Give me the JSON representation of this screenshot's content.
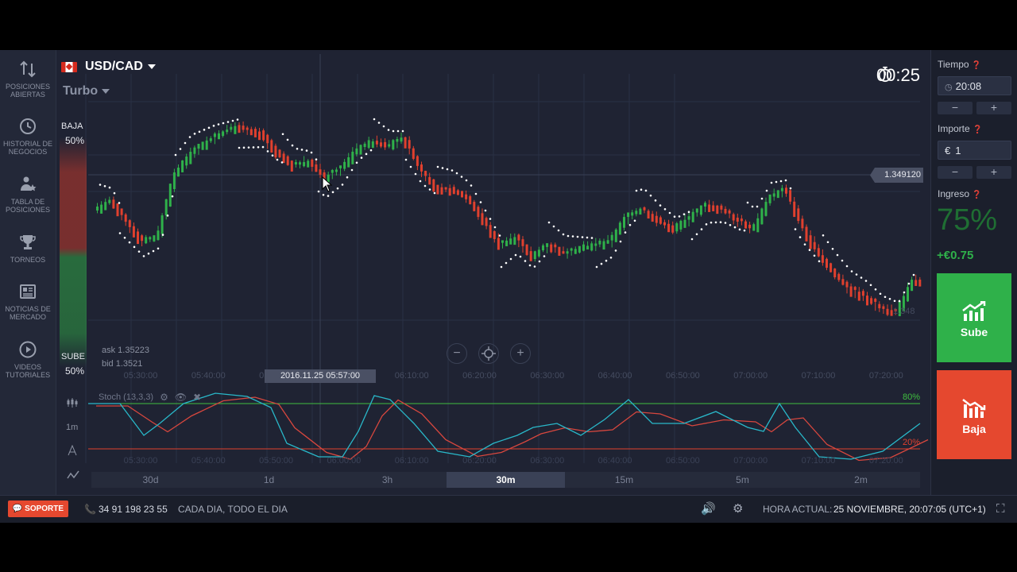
{
  "sidebar": {
    "items": [
      {
        "label1": "POSICIONES",
        "label2": "ABIERTAS",
        "icon": "up-down-arrows-icon"
      },
      {
        "label1": "HISTORIAL DE",
        "label2": "NEGOCIOS",
        "icon": "history-clock-icon"
      },
      {
        "label1": "TABLA DE",
        "label2": "POSICIONES",
        "icon": "leaderboard-icon"
      },
      {
        "label1": "TORNEOS",
        "label2": "",
        "icon": "trophy-icon"
      },
      {
        "label1": "NOTICIAS DE",
        "label2": "MERCADO",
        "icon": "newspaper-icon"
      },
      {
        "label1": "VIDEOS",
        "label2": "TUTORIALES",
        "icon": "play-circle-icon"
      }
    ]
  },
  "header": {
    "pair": "USD/CAD",
    "mode": "Turbo",
    "timer": "00:25"
  },
  "sentiment": {
    "baja_label": "BAJA",
    "baja_pct": "50%",
    "sube_label": "SUBE",
    "sube_pct": "50%"
  },
  "quotes": {
    "ask": "ask 1.35223",
    "bid": "bid 1.3521",
    "current_price": "1.349120",
    "faint_price": "1.348",
    "cursor_time": "2016.11.25 05:57:00"
  },
  "time_axis": [
    "05:30:00",
    "05:40:00",
    "05:50:00",
    "06:00:00",
    "06:10:00",
    "06:20:00",
    "06:30:00",
    "06:40:00",
    "06:50:00",
    "07:00:00",
    "07:10:00",
    "07:20:00"
  ],
  "indicator": {
    "name": "Stoch (13,3,3)",
    "level_high": "80%",
    "level_low": "20%",
    "tools": [
      "1m"
    ]
  },
  "timeframes": [
    {
      "label": "30d",
      "active": false
    },
    {
      "label": "1d",
      "active": false
    },
    {
      "label": "3h",
      "active": false
    },
    {
      "label": "30m",
      "active": true
    },
    {
      "label": "15m",
      "active": false
    },
    {
      "label": "5m",
      "active": false
    },
    {
      "label": "2m",
      "active": false
    }
  ],
  "right_panel": {
    "tiempo_label": "Tiempo",
    "tiempo_value": "20:08",
    "importe_label": "Importe",
    "importe_currency": "€",
    "importe_value": "1",
    "ingreso_label": "Ingreso",
    "ingreso_pct": "75%",
    "ingreso_amount": "+€0.75",
    "sube_label": "Sube",
    "baja_label": "Baja",
    "minus": "−",
    "plus": "+"
  },
  "footer": {
    "support": "SOPORTE",
    "phone": "34 91 198 23 55",
    "schedule": "CADA DIA, TODO EL DIA",
    "time_label": "HORA ACTUAL:",
    "time_value": "25 NOVIEMBRE, 20:07:05 (UTC+1)"
  },
  "colors": {
    "up": "#2fb14a",
    "down": "#e0402e",
    "stoch_k": "#29b8c9",
    "stoch_d": "#d8473e",
    "level_high": "#3fbf3f",
    "level_low": "#e0402e"
  }
}
